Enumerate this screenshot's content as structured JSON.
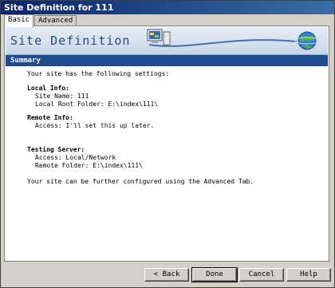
{
  "window": {
    "title": "Site Definition for 111"
  },
  "tabs": [
    {
      "label": "Basic"
    },
    {
      "label": "Advanced"
    }
  ],
  "banner": {
    "title": "Site Definition"
  },
  "summary": {
    "header": "Summary",
    "intro": "Your site has the following settings:",
    "local_info": {
      "heading": "Local Info:",
      "site_name": "Site Name: 111",
      "root_folder": "Local Root Folder: E:\\index\\111\\"
    },
    "remote_info": {
      "heading": "Remote Info:",
      "access": "Access: I'll set this up later."
    },
    "testing_server": {
      "heading": "Testing Server:",
      "access": "Access: Local/Network",
      "remote_folder": "Remote Folder: E:\\index\\111\\"
    },
    "footer": "Your site can be further configured using the Advanced Tab."
  },
  "buttons": {
    "back": "< Back",
    "done": "Done",
    "cancel": "Cancel",
    "help": "Help"
  },
  "icons": {
    "banner_icon": "computer-globe-icon"
  }
}
